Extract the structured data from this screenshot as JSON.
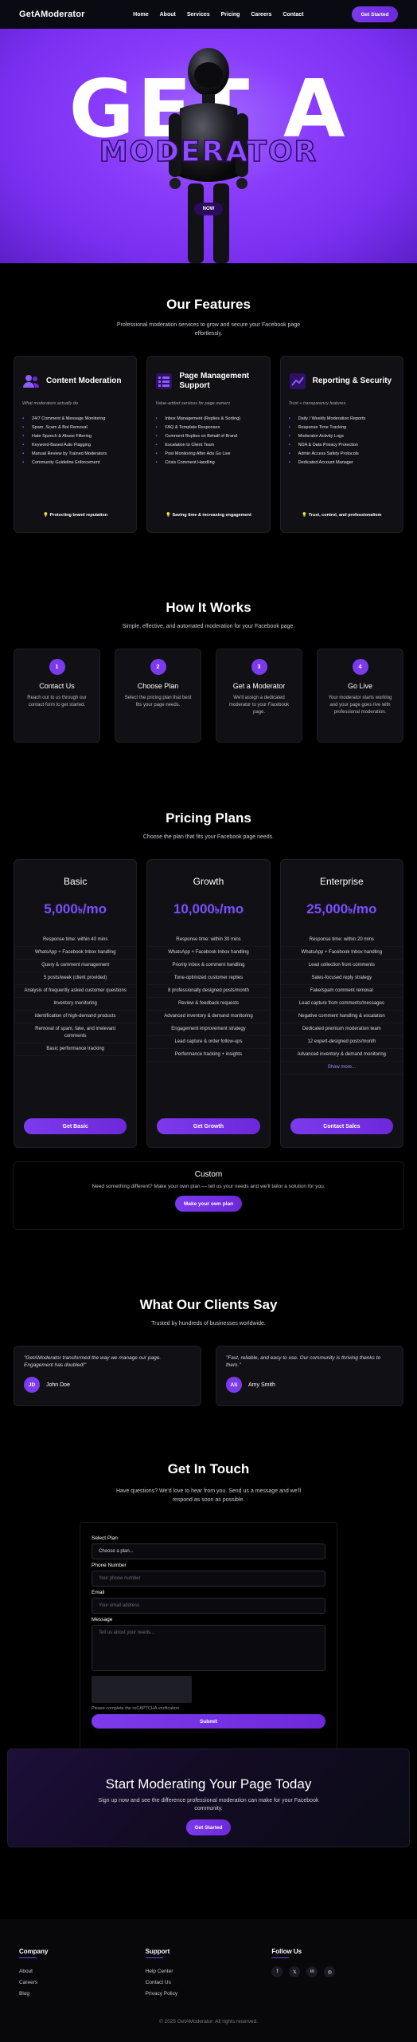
{
  "nav": {
    "logo": "GetAModerator",
    "links": [
      "Home",
      "About",
      "Services",
      "Pricing",
      "Careers",
      "Contact"
    ],
    "cta": "Get Started"
  },
  "hero": {
    "big_text": "GET A",
    "brand_text": "MODERATOR",
    "button": "NOW"
  },
  "features": {
    "title": "Our Features",
    "subtitle": "Professional moderation services to grow and secure your Facebook page effortlessly.",
    "cards": [
      {
        "title": "Content Moderation",
        "subtitle": "What moderators actually do",
        "items": [
          "24/7 Comment & Message Monitoring",
          "Spam, Scam & Bot Removal",
          "Hate Speech & Abuse Filtering",
          "Keyword-Based Auto Flagging",
          "Manual Review by Trained Moderators",
          "Community Guideline Enforcement"
        ],
        "footer": "Protecting brand reputation"
      },
      {
        "title": "Page Management Support",
        "subtitle": "Value-added services for page owners",
        "items": [
          "Inbox Management (Replies & Sorting)",
          "FAQ & Template Responses",
          "Comment Replies on Behalf of Brand",
          "Escalation to Client Team",
          "Post Monitoring After Ads Go Live",
          "Crisis Comment Handling"
        ],
        "footer": "Saving time & increasing engagement"
      },
      {
        "title": "Reporting & Security",
        "subtitle": "Trust + transparency features",
        "items": [
          "Daily / Weekly Moderation Reports",
          "Response Time Tracking",
          "Moderator Activity Logs",
          "NDA & Data Privacy Protection",
          "Admin Access Safety Protocols",
          "Dedicated Account Manager"
        ],
        "footer": "Trust, control, and professionalism"
      }
    ]
  },
  "how": {
    "title": "How It Works",
    "subtitle": "Simple, effective, and automated moderation for your Facebook page.",
    "steps": [
      {
        "num": "1",
        "title": "Contact Us",
        "desc": "Reach out to us through our contact form to get started."
      },
      {
        "num": "2",
        "title": "Choose Plan",
        "desc": "Select the pricing plan that best fits your page needs."
      },
      {
        "num": "3",
        "title": "Get a Moderator",
        "desc": "We'll assign a dedicated moderator to your Facebook page."
      },
      {
        "num": "4",
        "title": "Go Live",
        "desc": "Your moderator starts working and your page goes live with professional moderation."
      }
    ]
  },
  "pricing": {
    "title": "Pricing Plans",
    "subtitle": "Choose the plan that fits your Facebook page needs.",
    "plans": [
      {
        "name": "Basic",
        "price": "5,000",
        "currency": "৳",
        "period": "/mo",
        "features": [
          "Response time: within 40 mins",
          "WhatsApp + Facebook Inbox handling",
          "Query & comment management",
          "5 posts/week (client provided)",
          "Analysis of frequently asked customer questions",
          "Inventory monitoring",
          "Identification of high-demand products",
          "Removal of spam, fake, and irrelevant comments",
          "Basic performance tracking"
        ],
        "button": "Get Basic"
      },
      {
        "name": "Growth",
        "price": "10,000",
        "currency": "৳",
        "period": "/mo",
        "features": [
          "Response time: within 30 mins",
          "WhatsApp + Facebook Inbox handling",
          "Priority inbox & comment handling",
          "Tone-optimized customer replies",
          "8 professionally designed posts/month",
          "Review & feedback requests",
          "Advanced inventory & demand monitoring",
          "Engagement improvement strategy",
          "Lead capture & order follow-ups",
          "Performance tracking + insights"
        ],
        "button": "Get Growth"
      },
      {
        "name": "Enterprise",
        "price": "25,000",
        "currency": "৳",
        "period": "/mo",
        "features": [
          "Response time: within 20 mins",
          "WhatsApp + Facebook Inbox handling",
          "Lead collection from comments",
          "Sales-focused reply strategy",
          "Fake/spam comment removal",
          "Lead capture from comments/messages",
          "Negative comment handling & escalation",
          "Dedicated premium moderation team",
          "12 expert-designed posts/month",
          "Advanced inventory & demand monitoring"
        ],
        "more": "Show more...",
        "button": "Contact Sales"
      }
    ],
    "custom": {
      "title": "Custom",
      "desc": "Need something different? Make your own plan — tell us your needs and we'll tailor a solution for you.",
      "button": "Make your own plan"
    }
  },
  "testimonials": {
    "title": "What Our Clients Say",
    "subtitle": "Trusted by hundreds of businesses worldwide.",
    "items": [
      {
        "quote": "\"GetAModerator transformed the way we manage our page. Engagement has doubled!\"",
        "initials": "JD",
        "name": "John Doe"
      },
      {
        "quote": "\"Fast, reliable, and easy to use. Our community is thriving thanks to them.\"",
        "initials": "AS",
        "name": "Amy Smith"
      }
    ]
  },
  "contact": {
    "title": "Get In Touch",
    "subtitle": "Have questions? We'd love to hear from you. Send us a message and we'll respond as soon as possible.",
    "plan_label": "Select Plan",
    "plan_value": "Choose a plan...",
    "phone_label": "Phone Number",
    "phone_placeholder": "Your phone number",
    "email_label": "Email",
    "email_placeholder": "Your email address",
    "message_label": "Message",
    "message_placeholder": "Tell us about your needs...",
    "captcha_note": "Please complete the reCAPTCHA verification",
    "submit": "Submit"
  },
  "cta": {
    "title": "Start Moderating Your Page Today",
    "desc": "Sign up now and see the difference professional moderation can make for your Facebook community.",
    "button": "Get Started"
  },
  "footer": {
    "company_title": "Company",
    "company_links": [
      "About",
      "Careers",
      "Blog"
    ],
    "support_title": "Support",
    "support_links": [
      "Help Center",
      "Contact Us",
      "Privacy Policy"
    ],
    "follow_title": "Follow Us",
    "social": [
      "f",
      "𝕏",
      "in",
      "◎"
    ],
    "copyright": "© 2025 GetAModerator. All rights reserved."
  },
  "colors": {
    "accent": "#7c3aed",
    "hero": "#8a3dfb",
    "price": "#7c4dff"
  }
}
